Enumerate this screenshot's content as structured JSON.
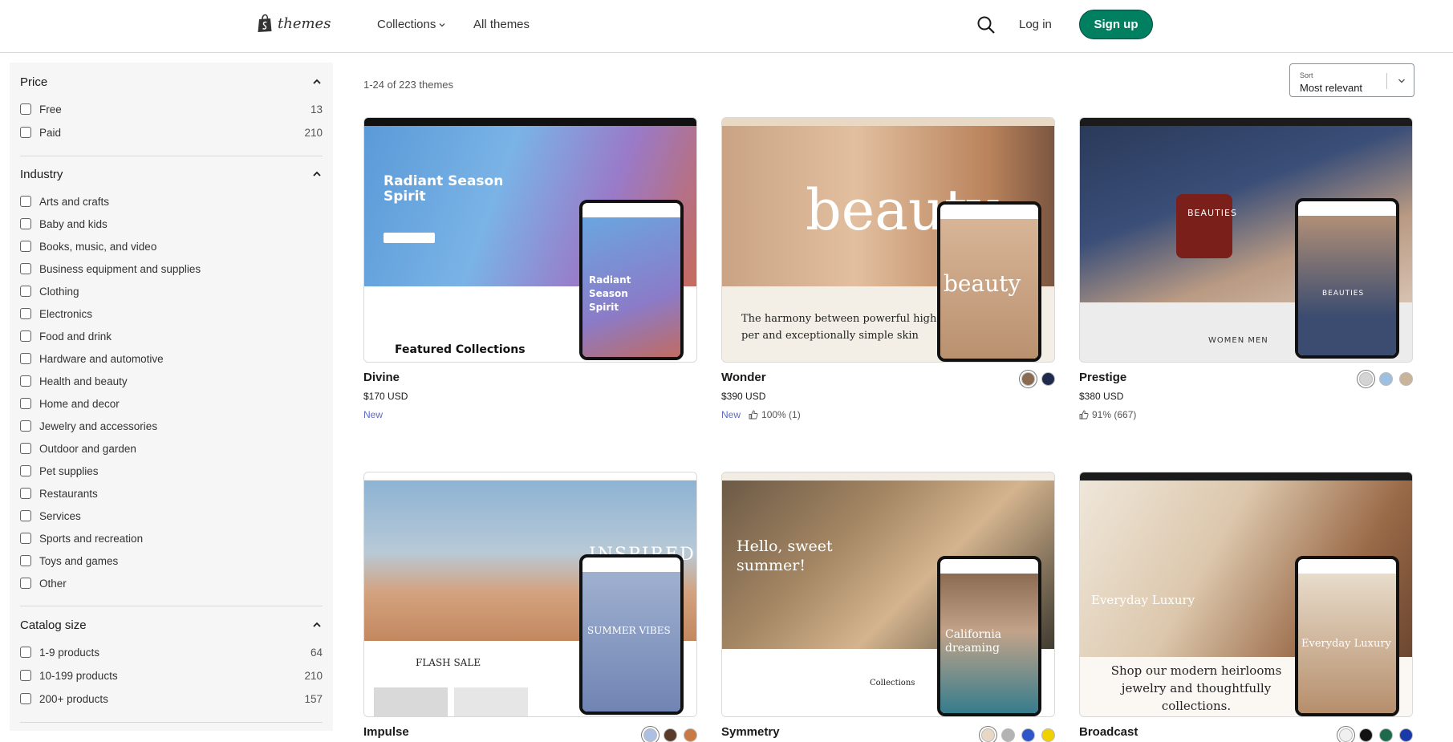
{
  "header": {
    "logo_text": "themes",
    "nav": {
      "collections": "Collections",
      "all_themes": "All themes"
    },
    "login": "Log in",
    "signup": "Sign up"
  },
  "sidebar": {
    "price": {
      "title": "Price",
      "items": [
        {
          "label": "Free",
          "count": "13"
        },
        {
          "label": "Paid",
          "count": "210"
        }
      ]
    },
    "industry": {
      "title": "Industry",
      "items": [
        "Arts and crafts",
        "Baby and kids",
        "Books, music, and video",
        "Business equipment and supplies",
        "Clothing",
        "Electronics",
        "Food and drink",
        "Hardware and automotive",
        "Health and beauty",
        "Home and decor",
        "Jewelry and accessories",
        "Outdoor and garden",
        "Pet supplies",
        "Restaurants",
        "Services",
        "Sports and recreation",
        "Toys and games",
        "Other"
      ]
    },
    "catalog": {
      "title": "Catalog size",
      "items": [
        {
          "label": "1-9 products",
          "count": "64"
        },
        {
          "label": "10-199 products",
          "count": "210"
        },
        {
          "label": "200+ products",
          "count": "157"
        }
      ]
    }
  },
  "results": {
    "count_text": "1-24 of 223 themes",
    "sort_label": "Sort",
    "sort_value": "Most relevant"
  },
  "themes": [
    {
      "name": "Divine",
      "price": "$170 USD",
      "new": "New",
      "rating": "",
      "swatches": [],
      "preview": {
        "headline": "Radiant Season Spirit",
        "sub": "Featured Collections",
        "phone_text": "Radiant Season Spirit"
      }
    },
    {
      "name": "Wonder",
      "price": "$390 USD",
      "new": "New",
      "rating": "100% (1)",
      "swatches": [
        "#8a6a50",
        "#1f2a4d"
      ],
      "preview": {
        "headline": "beauty",
        "sub": "The harmony between powerful high-per and exceptionally simple skin",
        "phone_text": "beauty"
      }
    },
    {
      "name": "Prestige",
      "price": "$380 USD",
      "new": "",
      "rating": "91% (667)",
      "swatches": [
        "#d4d4d4",
        "#9dbfe0",
        "#c9b49a"
      ],
      "preview": {
        "headline": "BEAUTIES",
        "sub": "WOMEN   MEN",
        "phone_text": "BEAUTIES"
      }
    },
    {
      "name": "Impulse",
      "price": "",
      "new": "",
      "rating": "",
      "swatches": [
        "#aebfe4",
        "#5a3a2a",
        "#c97a44"
      ],
      "preview": {
        "headline": "INSPIRED",
        "sub": "FLASH SALE",
        "phone_text": "SUMMER VIBES"
      }
    },
    {
      "name": "Symmetry",
      "price": "",
      "new": "",
      "rating": "",
      "swatches": [
        "#e9d7c6",
        "#b3b3b3",
        "#2e55c9",
        "#f0d000"
      ],
      "preview": {
        "headline": "Hello, sweet summer!",
        "sub": "Collections",
        "phone_text": "California dreaming"
      }
    },
    {
      "name": "Broadcast",
      "price": "",
      "new": "",
      "rating": "",
      "swatches": [
        "#f0f0f0",
        "#111111",
        "#1d6b4a",
        "#1a3aa8"
      ],
      "preview": {
        "headline": "Everyday Luxury",
        "sub": "Shop our modern heirlooms jewelry and thoughtfully collections.",
        "phone_text": "Everyday Luxury"
      }
    }
  ]
}
